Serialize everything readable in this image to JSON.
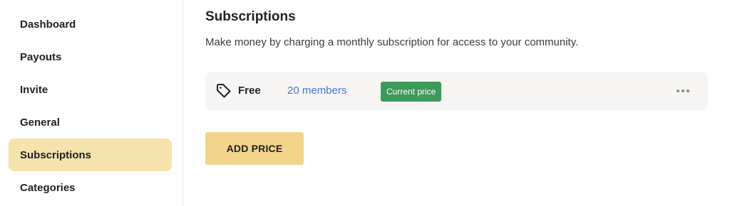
{
  "sidebar": {
    "items": [
      {
        "label": "Dashboard"
      },
      {
        "label": "Payouts"
      },
      {
        "label": "Invite"
      },
      {
        "label": "General"
      },
      {
        "label": "Subscriptions",
        "active": true
      },
      {
        "label": "Categories"
      }
    ]
  },
  "main": {
    "title": "Subscriptions",
    "description": "Make money by charging a monthly subscription for access to your community.",
    "price_row": {
      "icon": "tag-icon",
      "name": "Free",
      "members": "20 members",
      "badge": "Current price",
      "more_icon": "more-horizontal-icon"
    },
    "add_price_label": "ADD PRICE"
  },
  "colors": {
    "active_nav_bg": "#f5e2ad",
    "link": "#4a74d6",
    "badge_bg": "#3d9a5b",
    "button_bg": "#f1d48a",
    "row_bg": "#f6f5f3"
  }
}
